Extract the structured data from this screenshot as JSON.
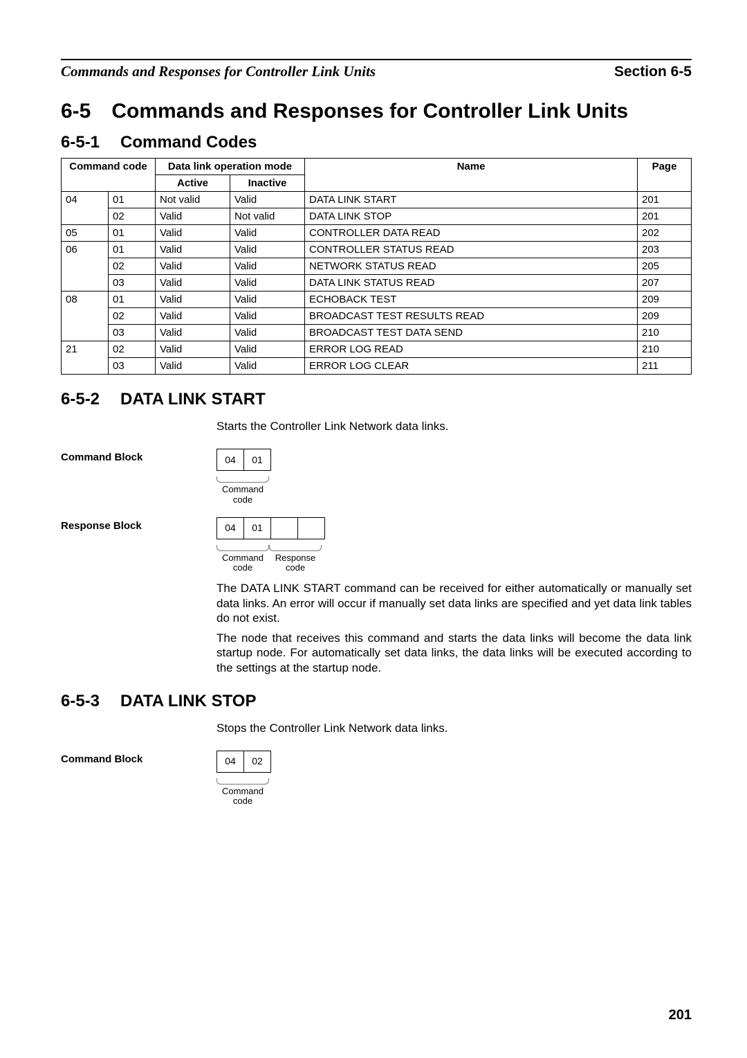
{
  "header": {
    "left": "Commands and Responses for Controller Link Units",
    "right": "Section 6-5"
  },
  "h1": {
    "num": "6-5",
    "title": "Commands and Responses for Controller Link Units"
  },
  "h2a": {
    "num": "6-5-1",
    "title": "Command Codes"
  },
  "table": {
    "head": {
      "command_code": "Command code",
      "mode": "Data link operation mode",
      "active": "Active",
      "inactive": "Inactive",
      "name": "Name",
      "page": "Page"
    },
    "rows": [
      {
        "c1": "04",
        "c2": "01",
        "act": "Not valid",
        "inact": "Valid",
        "name": "DATA LINK START",
        "page": "201",
        "newgroup": true
      },
      {
        "c1": "",
        "c2": "02",
        "act": "Valid",
        "inact": "Not valid",
        "name": "DATA LINK STOP",
        "page": "201"
      },
      {
        "c1": "05",
        "c2": "01",
        "act": "Valid",
        "inact": "Valid",
        "name": "CONTROLLER DATA READ",
        "page": "202",
        "newgroup": true
      },
      {
        "c1": "06",
        "c2": "01",
        "act": "Valid",
        "inact": "Valid",
        "name": "CONTROLLER STATUS READ",
        "page": "203",
        "newgroup": true
      },
      {
        "c1": "",
        "c2": "02",
        "act": "Valid",
        "inact": "Valid",
        "name": "NETWORK STATUS READ",
        "page": "205"
      },
      {
        "c1": "",
        "c2": "03",
        "act": "Valid",
        "inact": "Valid",
        "name": "DATA LINK STATUS READ",
        "page": "207"
      },
      {
        "c1": "08",
        "c2": "01",
        "act": "Valid",
        "inact": "Valid",
        "name": "ECHOBACK TEST",
        "page": "209",
        "newgroup": true
      },
      {
        "c1": "",
        "c2": "02",
        "act": "Valid",
        "inact": "Valid",
        "name": "BROADCAST TEST RESULTS READ",
        "page": "209"
      },
      {
        "c1": "",
        "c2": "03",
        "act": "Valid",
        "inact": "Valid",
        "name": "BROADCAST TEST DATA SEND",
        "page": "210"
      },
      {
        "c1": "21",
        "c2": "02",
        "act": "Valid",
        "inact": "Valid",
        "name": "ERROR LOG READ",
        "page": "210",
        "newgroup": true
      },
      {
        "c1": "",
        "c2": "03",
        "act": "Valid",
        "inact": "Valid",
        "name": "ERROR LOG CLEAR",
        "page": "211"
      }
    ]
  },
  "h2b": {
    "num": "6-5-2",
    "title": "DATA LINK START"
  },
  "dls": {
    "intro": "Starts the Controller Link Network data links.",
    "label_cmd": "Command Block",
    "label_resp": "Response Block",
    "cmd_bytes": [
      "04",
      "01"
    ],
    "resp_bytes": [
      "04",
      "01",
      "",
      ""
    ],
    "label_cmdcode": "Command code",
    "label_respcode": "Response code",
    "p1": "The DATA LINK START command can be received for either automatically or manually set data links. An error will occur if manually set data links are specified and yet data link tables do not exist.",
    "p2": "The node that receives this command and starts the data links will become the data link startup node. For automatically set data links, the data links will be executed according to the settings at the startup node."
  },
  "h2c": {
    "num": "6-5-3",
    "title": "DATA LINK STOP"
  },
  "dlstop": {
    "intro": "Stops the Controller Link Network data links.",
    "label_cmd": "Command Block",
    "cmd_bytes": [
      "04",
      "02"
    ],
    "label_cmdcode": "Command code"
  },
  "pagenum": "201"
}
